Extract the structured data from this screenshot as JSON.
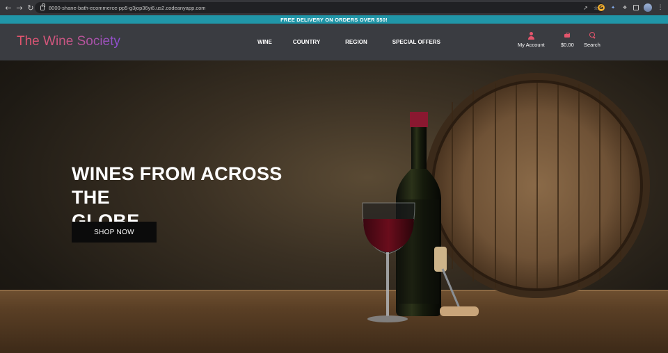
{
  "browser": {
    "url": "8000-shane-bath-ecommerce-pp5-g3jop36yi6.us2.codeanyapp.com",
    "back_icon": "arrow-left",
    "forward_icon": "arrow-right",
    "reload_icon": "reload"
  },
  "promo": {
    "text": "FREE DELIVERY ON ORDERS OVER $50!",
    "color": "#2096a8"
  },
  "header": {
    "logo": "The Wine Society",
    "nav": {
      "wine": "WINE",
      "country": "COUNTRY",
      "region": "REGION",
      "special_offers": "SPECIAL OFFERS"
    },
    "account_label": "My Account",
    "cart_total": "$0.00",
    "search_label": "Search",
    "accent_color": "#e4556c"
  },
  "hero": {
    "title_line1": "WINES FROM ACROSS THE",
    "title_line2": "GLOBE.",
    "cta": "SHOP NOW"
  }
}
